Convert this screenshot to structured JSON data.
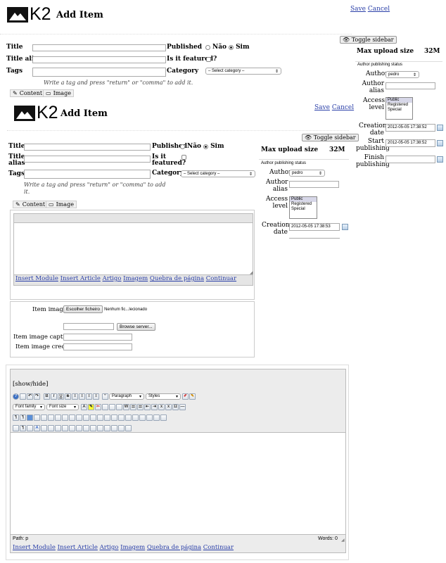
{
  "screen1": {
    "logo_text": "K2",
    "page_title": "Add Item",
    "save": "Save",
    "cancel": "Cancel",
    "toggle_sidebar": "Toggle sidebar",
    "title_label": "Title",
    "alias_label": "Title alias",
    "tags_label": "Tags",
    "tags_hint": "Write a tag and press \"return\" or \"comma\" to add it.",
    "published_label": "Published",
    "no": "Não",
    "yes": "Sim",
    "featured_label": "Is it featured?",
    "category_label": "Category",
    "category_value": "– Select category –",
    "tab_content": "Content",
    "tab_image": "Image",
    "max_upload_label": "Max upload size",
    "max_upload_value": "32M",
    "author_status": "Author publishing status",
    "author_label": "Author",
    "author_value": "pedro",
    "author_alias_label": "Author alias",
    "access_label": "Access level",
    "access_options": [
      "Public",
      "Registered",
      "Special"
    ],
    "creation_label": "Creation date",
    "creation_value": "2012-05-05 17:38:52",
    "start_label": "Start publishing",
    "start_value": "2012-05-05 17:38:52",
    "finish_label": "Finish publishing"
  },
  "screen2": {
    "logo_text": "K2",
    "page_title": "Add Item",
    "save": "Save",
    "cancel": "Cancel",
    "toggle_sidebar": "Toggle sidebar",
    "title_label": "Title",
    "alias_label_1": "Title",
    "alias_label_2": "alias",
    "tags_label": "Tags",
    "tags_hint_1": "Write a tag and press \"return\" or \"comma\" to add",
    "tags_hint_2": "it.",
    "published_label": "Published",
    "no": "Não",
    "yes": "Sim",
    "featured_label_1": "Is it",
    "featured_label_2": "featured?",
    "category_label": "Category",
    "category_value": "– Select category –",
    "tab_content": "Content",
    "tab_image": "Image",
    "max_upload_label": "Max upload size",
    "max_upload_value": "32M",
    "author_status": "Author publishing status",
    "author_label": "Author",
    "author_value": "pedro",
    "author_alias_label_1": "Author",
    "author_alias_label_2": "alias",
    "access_label_1": "Access",
    "access_label_2": "level",
    "access_options": [
      "Public",
      "Registered",
      "Special"
    ],
    "creation_label_1": "Creation",
    "creation_label_2": "date",
    "creation_value": "2012-05-05 17:38:53",
    "editor_links": [
      "Insert Module",
      "Insert Article",
      "Artigo",
      "Imagem",
      "Quebra de página",
      "Continuar"
    ],
    "item_image_label": "Item image",
    "choose_file": "Escolher ficheiro",
    "no_file": "Nenhum fic...lecionado",
    "browse_server": "Browse server...",
    "caption_label": "Item image caption",
    "credits_label": "Item image credits"
  },
  "editor": {
    "show_hide": "[show/hide]",
    "format_value": "Paragraph",
    "styles_value": "Styles",
    "font_family": "Font family",
    "font_size": "Font size",
    "path": "Path: p",
    "words": "Words: 0",
    "links": [
      "Insert Module",
      "Insert Article",
      "Artigo",
      "Imagem",
      "Quebra de página",
      "Continuar"
    ]
  }
}
